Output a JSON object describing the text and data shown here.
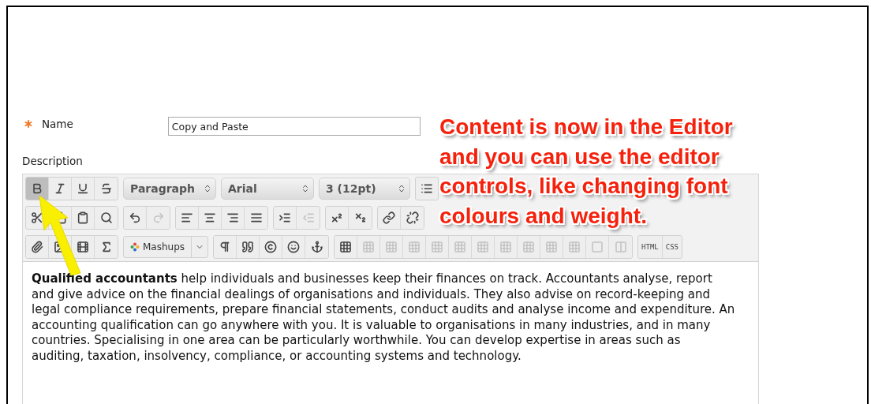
{
  "form": {
    "name_field": {
      "label": "Name",
      "required": true,
      "value": "Copy and Paste"
    },
    "description_label": "Description"
  },
  "editor": {
    "format_buttons": [
      {
        "selected": true
      },
      {
        "selected": false
      },
      {
        "selected": false
      },
      {
        "selected": false
      }
    ],
    "selects": [
      "Paragraph",
      "Arial",
      "3 (12pt)"
    ],
    "mashups": "Mashups",
    "code_buttons": [
      "HTML",
      "CSS"
    ],
    "content": "**Qualified accountants** help individuals and businesses keep their finances on track. Accountants analyse, report and give advice on the financial dealings of organisations and individuals. They also advise on record-keeping and legal compliance requirements, prepare financial statements, conduct audits and analyse income and expenditure. An accounting qualification can go anywhere with you. It is valuable to organisations in many industries, and in many countries. Specialising in one area can be particularly worthwhile. You can develop expertise in areas such as auditing, taxation, insolvency, compliance, or accounting systems and technology."
  },
  "annotation": {
    "lines": [
      "Content is now in the Editor",
      "and you can use the editor",
      "controls, like changing font",
      "colours and weight."
    ]
  }
}
